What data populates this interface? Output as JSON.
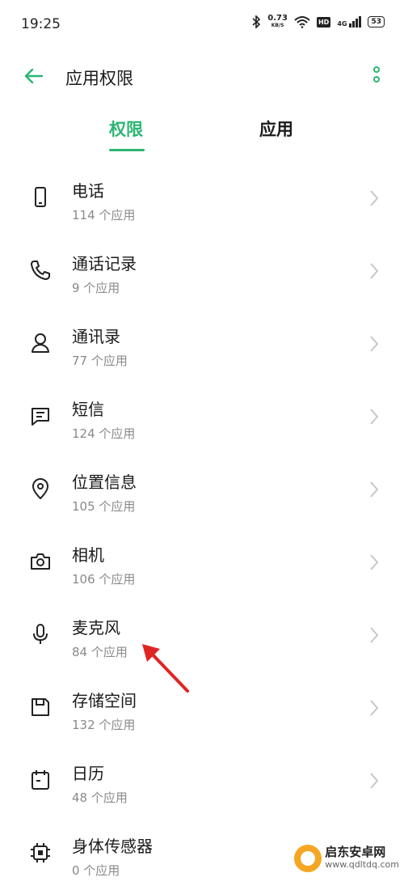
{
  "status": {
    "time": "19:25",
    "speed_value": "0.73",
    "speed_unit": "KB/S",
    "hd": "HD",
    "network": "4G",
    "battery": "53"
  },
  "header": {
    "title": "应用权限"
  },
  "tabs": [
    {
      "label": "权限",
      "selected": true
    },
    {
      "label": "应用",
      "selected": false
    }
  ],
  "permissions": [
    {
      "label": "电话",
      "count": "114 个应用",
      "icon": "phone-icon"
    },
    {
      "label": "通话记录",
      "count": "9 个应用",
      "icon": "call-log-icon"
    },
    {
      "label": "通讯录",
      "count": "77 个应用",
      "icon": "contacts-icon"
    },
    {
      "label": "短信",
      "count": "124 个应用",
      "icon": "sms-icon"
    },
    {
      "label": "位置信息",
      "count": "105 个应用",
      "icon": "location-icon"
    },
    {
      "label": "相机",
      "count": "106 个应用",
      "icon": "camera-icon"
    },
    {
      "label": "麦克风",
      "count": "84 个应用",
      "icon": "microphone-icon"
    },
    {
      "label": "存储空间",
      "count": "132 个应用",
      "icon": "storage-icon"
    },
    {
      "label": "日历",
      "count": "48 个应用",
      "icon": "calendar-icon"
    },
    {
      "label": "身体传感器",
      "count": "0 个应用",
      "icon": "body-sensor-icon"
    }
  ],
  "watermark": {
    "title": "启东安卓网",
    "url": "www.qdltdq.com"
  },
  "colors": {
    "accent": "#2bb673",
    "annotation_arrow": "#e02424"
  }
}
